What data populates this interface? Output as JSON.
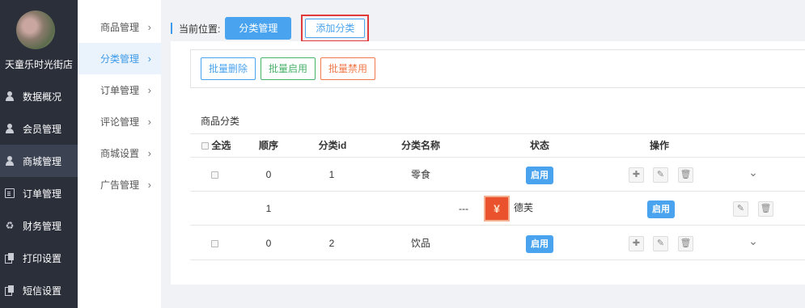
{
  "shop": {
    "name": "天童乐时光街店"
  },
  "nav": [
    {
      "label": "数据概况",
      "icon": "person-icon"
    },
    {
      "label": "会员管理",
      "icon": "person-icon"
    },
    {
      "label": "商城管理",
      "icon": "person-icon",
      "active": true
    },
    {
      "label": "订单管理",
      "icon": "document-icon"
    },
    {
      "label": "财务管理",
      "icon": "recycle-icon"
    },
    {
      "label": "打印设置",
      "icon": "copy-icon"
    },
    {
      "label": "短信设置",
      "icon": "copy-icon"
    }
  ],
  "submenu": [
    {
      "label": "商品管理"
    },
    {
      "label": "分类管理",
      "active": true
    },
    {
      "label": "订单管理"
    },
    {
      "label": "评论管理"
    },
    {
      "label": "商城设置"
    },
    {
      "label": "广告管理"
    }
  ],
  "breadcrumb": {
    "label": "当前位置:",
    "current": "分类管理",
    "add": "添加分类"
  },
  "batch": {
    "delete": "批量删除",
    "enable": "批量启用",
    "disable": "批量禁用"
  },
  "table": {
    "title": "商品分类",
    "headers": {
      "select_all": "全选",
      "order": "顺序",
      "id": "分类id",
      "name": "分类名称",
      "status": "状态",
      "actions": "操作"
    },
    "rows": [
      {
        "order": "0",
        "id": "1",
        "name": "零食",
        "status": "启用"
      },
      {
        "order": "1",
        "prefix": "---",
        "name": "德芙",
        "status": "启用"
      },
      {
        "order": "0",
        "id": "2",
        "name": "饮品",
        "status": "启用"
      }
    ]
  },
  "colors": {
    "accent": "#4aa3ee",
    "sidebar": "#2b2f3a",
    "highlight": "#e03a3a"
  }
}
